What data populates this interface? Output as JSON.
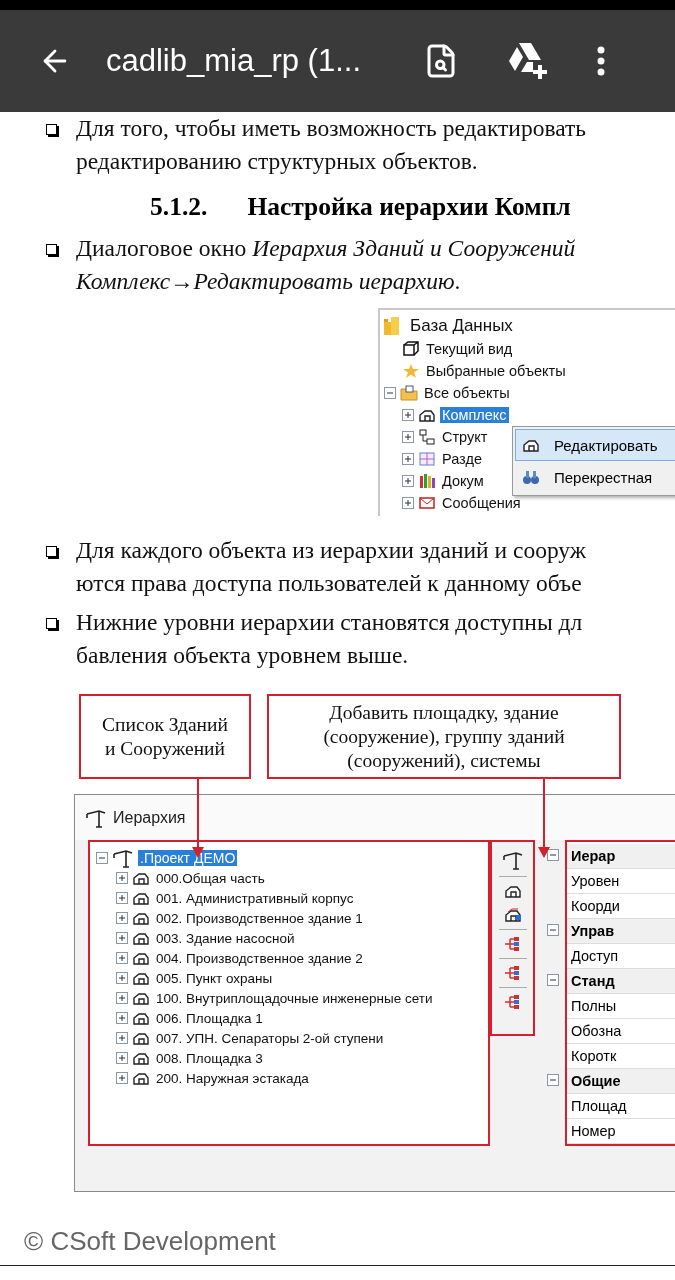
{
  "app_bar": {
    "title": "cadlib_mia_rp (1..."
  },
  "section_top": [
    {
      "kind": "bullet",
      "lines": [
        "Для того, чтобы иметь возможность редактировать",
        "редактированию структурных объектов."
      ]
    },
    {
      "kind": "heading",
      "number": "5.1.2.",
      "text": "Настройка иерархии Компл"
    },
    {
      "kind": "bullet",
      "lines": [
        "Диалоговое окно *Иерархия Зданий и Сооружений*",
        "*Комплекс→Редактировать иерархию*."
      ]
    }
  ],
  "db_figure": {
    "tree": {
      "label": "База Данных",
      "selected": false,
      "children": [
        {
          "label": "Текущий вид",
          "selected": false
        },
        {
          "label": "Выбранные объекты",
          "selected": false
        },
        {
          "label": "Все объекты",
          "selected": false,
          "expanded": true,
          "children": [
            {
              "label": "Комплекс",
              "selected": true,
              "expanded": false
            },
            {
              "label": "Структ",
              "selected": false,
              "expanded": false
            },
            {
              "label": "Разде",
              "selected": false,
              "expanded": false
            },
            {
              "label": "Докум",
              "selected": false,
              "expanded": false
            },
            {
              "label": "Сообщения",
              "selected": false,
              "expanded": false
            }
          ]
        }
      ]
    },
    "context_menu": [
      {
        "label": "Редактировать",
        "selected": true
      },
      {
        "label": "Перекрестная",
        "selected": false
      }
    ]
  },
  "section_mid": [
    {
      "kind": "bullet",
      "lines": [
        "Для каждого объекта из иерархии зданий и сооруж",
        "ются права доступа пользователей к данному объе"
      ]
    },
    {
      "kind": "bullet",
      "lines": [
        "Нижние уровни иерархии становятся доступны дл",
        "бавления объекта уровнем выше."
      ]
    }
  ],
  "hierarchy_figure": {
    "callouts": [
      "Список Зданий\nи Сооружений",
      "Добавить площадку, здание\n(сооружение), группу зданий\n(сооружений), системы"
    ],
    "window_title": "Иерархия",
    "tree": {
      "label": ".Проект ДЕМО",
      "selected": true,
      "expanded": true,
      "children": [
        {
          "label": "000.Общая часть",
          "selected": false,
          "expanded": false
        },
        {
          "label": "001. Административный корпус",
          "selected": false,
          "expanded": false
        },
        {
          "label": "002. Производственное здание 1",
          "selected": false,
          "expanded": false
        },
        {
          "label": "003. Здание насосной",
          "selected": false,
          "expanded": false
        },
        {
          "label": "004. Производственное здание 2",
          "selected": false,
          "expanded": false
        },
        {
          "label": "005. Пункт охраны",
          "selected": false,
          "expanded": false
        },
        {
          "label": "100. Внутриплощадочные инженерные сети",
          "selected": false,
          "expanded": false
        },
        {
          "label": "006. Площадка 1",
          "selected": false,
          "expanded": false
        },
        {
          "label": "007. УПН. Сепараторы 2-ой ступени",
          "selected": false,
          "expanded": false
        },
        {
          "label": "008. Площадка 3",
          "selected": false,
          "expanded": false
        },
        {
          "label": "200. Наружная эстакада",
          "selected": false,
          "expanded": false
        }
      ]
    },
    "properties": [
      {
        "kind": "category",
        "label": "Иерар",
        "expanded": true
      },
      {
        "kind": "field",
        "label": "Уровен"
      },
      {
        "kind": "field",
        "label": "Коорди"
      },
      {
        "kind": "category",
        "label": "Управ",
        "expanded": true
      },
      {
        "kind": "field",
        "label": "Доступ"
      },
      {
        "kind": "category",
        "label": "Станд",
        "expanded": true
      },
      {
        "kind": "field",
        "label": "Полны"
      },
      {
        "kind": "field",
        "label": "Обозна"
      },
      {
        "kind": "field",
        "label": "Коротк"
      },
      {
        "kind": "category",
        "label": "Общие",
        "expanded": true
      },
      {
        "kind": "field",
        "label": "Площад"
      },
      {
        "kind": "field",
        "label": "Номер"
      }
    ]
  },
  "footer": {
    "text": "© CSoft Development"
  }
}
